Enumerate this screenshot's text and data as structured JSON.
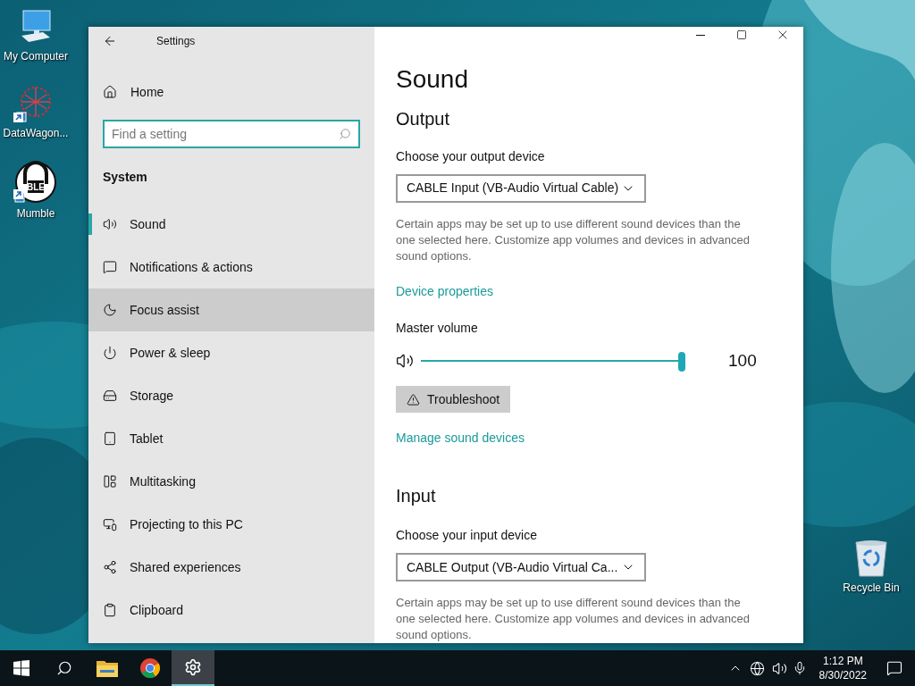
{
  "desktop_icons": [
    {
      "label": "My Computer",
      "kind": "computer",
      "shortcut": false
    },
    {
      "label": "DataWagon...",
      "kind": "network",
      "shortcut": true
    },
    {
      "label": "Mumble",
      "kind": "headset",
      "logo_text": "BLE",
      "shortcut": true
    },
    {
      "label": "Recycle Bin",
      "kind": "recycle",
      "shortcut": false
    }
  ],
  "window": {
    "title": "Settings"
  },
  "sidebar": {
    "home": "Home",
    "search": {
      "placeholder": "Find a setting"
    },
    "section": "System",
    "items": [
      {
        "label": "Sound",
        "kind": "speaker",
        "selected": true,
        "highlighted": false
      },
      {
        "label": "Notifications & actions",
        "kind": "message",
        "selected": false,
        "highlighted": false
      },
      {
        "label": "Focus assist",
        "kind": "moon",
        "selected": false,
        "highlighted": true
      },
      {
        "label": "Power & sleep",
        "kind": "power",
        "selected": false,
        "highlighted": false
      },
      {
        "label": "Storage",
        "kind": "storage",
        "selected": false,
        "highlighted": false
      },
      {
        "label": "Tablet",
        "kind": "tablet",
        "selected": false,
        "highlighted": false
      },
      {
        "label": "Multitasking",
        "kind": "multitasking",
        "selected": false,
        "highlighted": false
      },
      {
        "label": "Projecting to this PC",
        "kind": "projecting",
        "selected": false,
        "highlighted": false
      },
      {
        "label": "Shared experiences",
        "kind": "shared",
        "selected": false,
        "highlighted": false
      },
      {
        "label": "Clipboard",
        "kind": "clipboard",
        "selected": false,
        "highlighted": false
      }
    ]
  },
  "content": {
    "title": "Sound",
    "output": {
      "heading": "Output",
      "device_label": "Choose your output device",
      "device": "CABLE Input (VB-Audio Virtual Cable)",
      "note": "Certain apps may be set up to use different sound devices than the one selected here. Customize app volumes and devices in advanced sound options.",
      "link": "Device properties",
      "volume_label": "Master volume",
      "volume": {
        "level": 1,
        "reading": "100"
      },
      "troubleshoot": "Troubleshoot",
      "manage_link": "Manage sound devices"
    },
    "input": {
      "heading": "Input",
      "device_label": "Choose your input device",
      "device": "CABLE Output (VB-Audio Virtual Ca...",
      "note": "Certain apps may be set up to use different sound devices than the one selected here. Customize app volumes and devices in advanced sound options."
    }
  },
  "taskbar": {
    "apps": [
      {
        "kind": "start",
        "active": false
      },
      {
        "kind": "search",
        "active": false
      },
      {
        "kind": "folder",
        "active": false
      },
      {
        "kind": "browser",
        "active": false
      },
      {
        "kind": "settings",
        "active": true
      }
    ],
    "time": "1:12 PM",
    "date": "8/30/2022"
  }
}
